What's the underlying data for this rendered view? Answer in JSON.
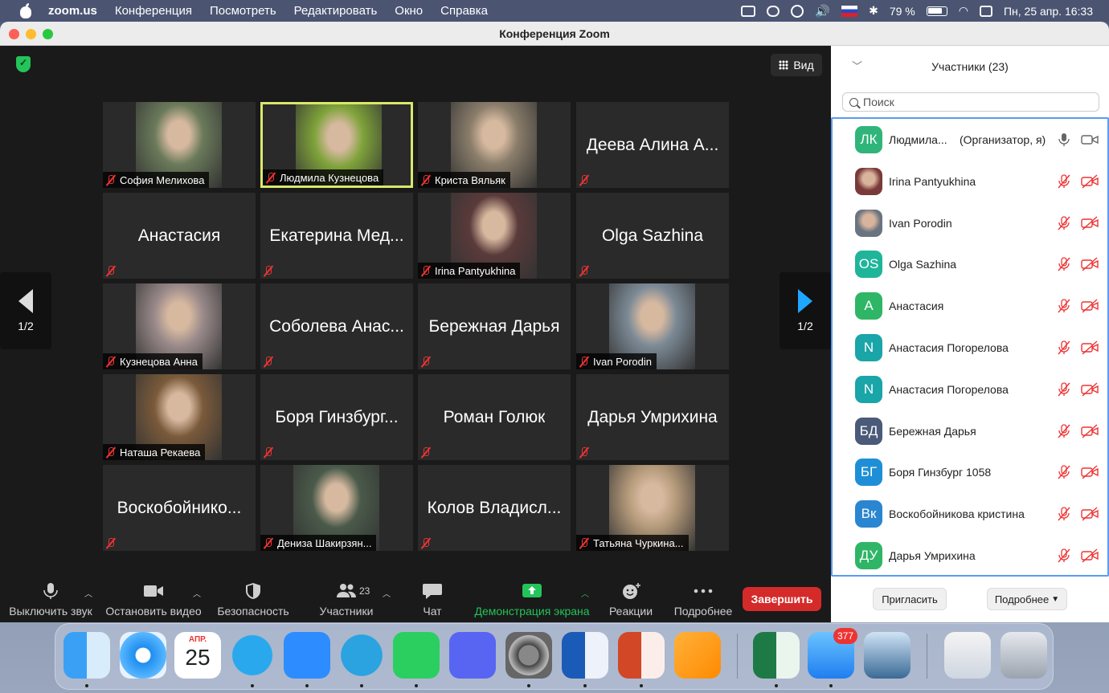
{
  "menubar": {
    "app": "zoom.us",
    "menus": [
      "Конференция",
      "Посмотреть",
      "Редактировать",
      "Окно",
      "Справка"
    ],
    "battery": "79 %",
    "datetime": "Пн, 25 апр.  16:33"
  },
  "window": {
    "title": "Конференция Zoom",
    "view_label": "Вид",
    "page_indicator_left": "1/2",
    "page_indicator_right": "1/2"
  },
  "tiles": [
    {
      "name": "София Мелихова",
      "type": "video",
      "color": "#6a7a5a"
    },
    {
      "name": "Людмила Кузнецова",
      "type": "video",
      "color": "#7fa33a",
      "active": true
    },
    {
      "name": "Криста Вяльяк",
      "type": "video",
      "color": "#8a7d6a"
    },
    {
      "name": "Деева Алина А...",
      "type": "name"
    },
    {
      "name": "Анастасия",
      "type": "name"
    },
    {
      "name": "Екатерина Мед...",
      "type": "name"
    },
    {
      "name": "Irina Pantyukhina",
      "type": "video",
      "color": "#5a3a3a"
    },
    {
      "name": "Olga Sazhina",
      "type": "name"
    },
    {
      "name": "Кузнецова Анна",
      "type": "video",
      "color": "#9a8a8a"
    },
    {
      "name": "Соболева Анас...",
      "type": "name"
    },
    {
      "name": "Бережная Дарья",
      "type": "name"
    },
    {
      "name": "Ivan Porodin",
      "type": "video",
      "color": "#7c8a96"
    },
    {
      "name": "Наташа Рекаева",
      "type": "video",
      "color": "#7a5a3a"
    },
    {
      "name": "Боря Гинзбург...",
      "type": "name"
    },
    {
      "name": "Роман Голюк",
      "type": "name"
    },
    {
      "name": "Дарья Умрихина",
      "type": "name"
    },
    {
      "name": "Воскобойнико...",
      "type": "name"
    },
    {
      "name": "Дениза Шакирзян...",
      "type": "video",
      "color": "#4a5a4a"
    },
    {
      "name": "Колов Владисл...",
      "type": "name"
    },
    {
      "name": "Татьяна Чуркина...",
      "type": "video",
      "color": "#b59a7a"
    }
  ],
  "toolbar": {
    "mute": "Выключить звук",
    "stop_video": "Остановить видео",
    "security": "Безопасность",
    "participants": "Участники",
    "participants_count": "23",
    "chat": "Чат",
    "share": "Демонстрация экрана",
    "reactions": "Реакции",
    "more": "Подробнее",
    "end": "Завершить"
  },
  "sidebar": {
    "title": "Участники (23)",
    "search_placeholder": "Поиск",
    "participants": [
      {
        "initials": "ЛК",
        "name": "Людмила...",
        "role": "(Организатор, я)",
        "color": "#2fb57a",
        "host": true
      },
      {
        "initials": "",
        "name": "Irina Pantyukhina",
        "color": "#7a3a3a",
        "photo": true
      },
      {
        "initials": "",
        "name": "Ivan Porodin",
        "color": "#6a7480",
        "photo": true
      },
      {
        "initials": "OS",
        "name": "Olga Sazhina",
        "color": "#1fb59a"
      },
      {
        "initials": "А",
        "name": "Анастасия",
        "color": "#2fb566"
      },
      {
        "initials": "N",
        "name": "Анастасия Погорелова",
        "color": "#1aa5a8"
      },
      {
        "initials": "N",
        "name": "Анастасия Погорелова",
        "color": "#1aa5a8"
      },
      {
        "initials": "БД",
        "name": "Бережная Дарья",
        "color": "#4a5a78"
      },
      {
        "initials": "БГ",
        "name": "Боря Гинзбург 1058",
        "color": "#1e8fd6"
      },
      {
        "initials": "Вк",
        "name": "Воскобойникова кристина",
        "color": "#2a86d0"
      },
      {
        "initials": "ДУ",
        "name": "Дарья Умрихина",
        "color": "#2fb566"
      }
    ],
    "invite": "Пригласить",
    "more": "Подробнее"
  },
  "dock": {
    "calendar_month": "АПР.",
    "calendar_day": "25",
    "mail_badge": "377"
  }
}
